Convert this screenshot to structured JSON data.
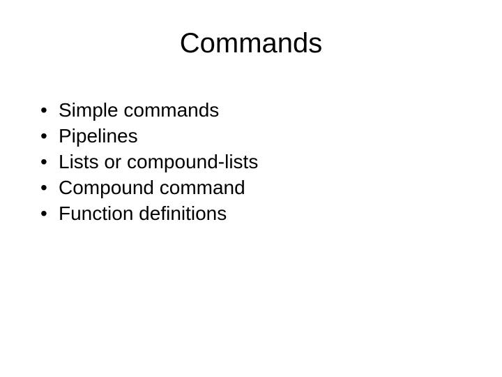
{
  "slide": {
    "title": "Commands",
    "bullets": [
      "Simple commands",
      "Pipelines",
      "Lists or compound-lists",
      "Compound command",
      "Function definitions"
    ],
    "bullet_glyph": "•"
  }
}
